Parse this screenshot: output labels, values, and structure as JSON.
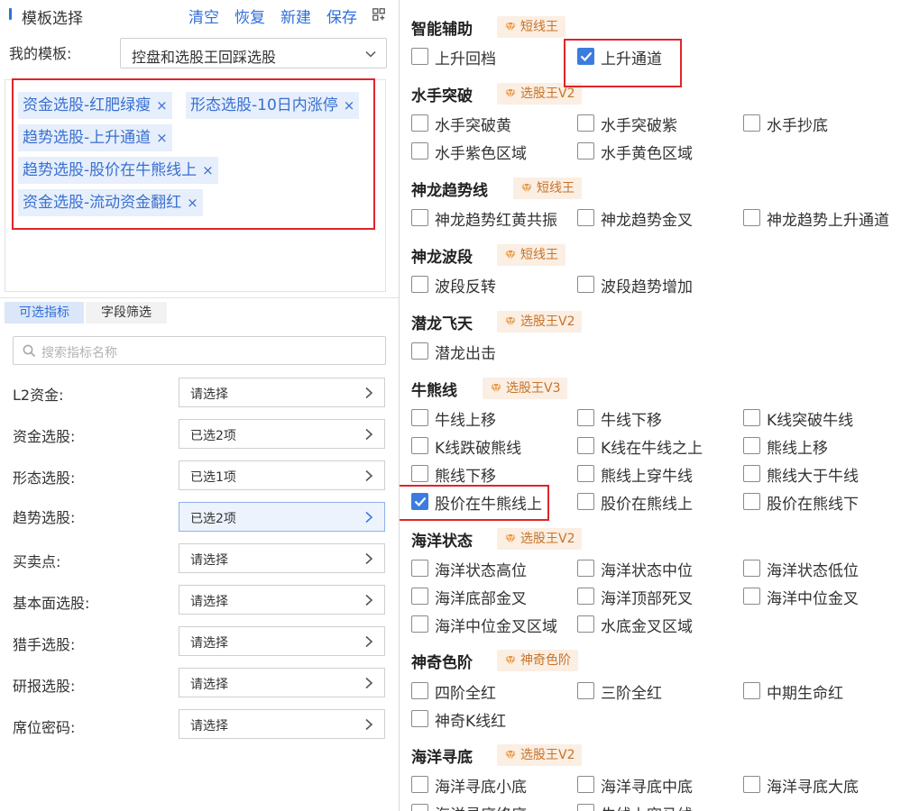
{
  "header": {
    "title": "模板选择",
    "actions": [
      "清空",
      "恢复",
      "新建",
      "保存"
    ]
  },
  "template": {
    "label": "我的模板:",
    "selected": "控盘和选股王回踩选股"
  },
  "selected_tags": [
    "资金选股-红肥绿瘦",
    "形态选股-10日内涨停",
    "趋势选股-上升通道",
    "趋势选股-股价在牛熊线上",
    "资金选股-流动资金翻红"
  ],
  "tabs": [
    "可选指标",
    "字段筛选"
  ],
  "search": {
    "placeholder": "搜索指标名称"
  },
  "filters": [
    {
      "label": "L2资金:",
      "value": "请选择"
    },
    {
      "label": "资金选股:",
      "value": "已选2项"
    },
    {
      "label": "形态选股:",
      "value": "已选1项"
    },
    {
      "label": "趋势选股:",
      "value": "已选2项"
    },
    {
      "label": "买卖点:",
      "value": "请选择"
    },
    {
      "label": "基本面选股:",
      "value": "请选择"
    },
    {
      "label": "猎手选股:",
      "value": "请选择"
    },
    {
      "label": "研报选股:",
      "value": "请选择"
    },
    {
      "label": "席位密码:",
      "value": "请选择"
    }
  ],
  "sections": [
    {
      "title": "智能辅助",
      "badge": "短线王",
      "items": [
        {
          "label": "上升回档",
          "checked": false
        },
        {
          "label": "上升通道",
          "checked": true
        }
      ]
    },
    {
      "title": "水手突破",
      "badge": "选股王V2",
      "items": [
        {
          "label": "水手突破黄",
          "checked": false
        },
        {
          "label": "水手突破紫",
          "checked": false
        },
        {
          "label": "水手抄底",
          "checked": false
        },
        {
          "label": "水手紫色区域",
          "checked": false
        },
        {
          "label": "水手黄色区域",
          "checked": false
        }
      ]
    },
    {
      "title": "神龙趋势线",
      "badge": "短线王",
      "items": [
        {
          "label": "神龙趋势红黄共振",
          "checked": false
        },
        {
          "label": "神龙趋势金叉",
          "checked": false
        },
        {
          "label": "神龙趋势上升通道",
          "checked": false
        }
      ]
    },
    {
      "title": "神龙波段",
      "badge": "短线王",
      "items": [
        {
          "label": "波段反转",
          "checked": false
        },
        {
          "label": "波段趋势增加",
          "checked": false
        }
      ]
    },
    {
      "title": "潜龙飞天",
      "badge": "选股王V2",
      "items": [
        {
          "label": "潜龙出击",
          "checked": false
        }
      ]
    },
    {
      "title": "牛熊线",
      "badge": "选股王V3",
      "items": [
        {
          "label": "牛线上移",
          "checked": false
        },
        {
          "label": "牛线下移",
          "checked": false
        },
        {
          "label": "K线突破牛线",
          "checked": false
        },
        {
          "label": "K线跌破熊线",
          "checked": false
        },
        {
          "label": "K线在牛线之上",
          "checked": false
        },
        {
          "label": "熊线上移",
          "checked": false
        },
        {
          "label": "熊线下移",
          "checked": false
        },
        {
          "label": "熊线上穿牛线",
          "checked": false
        },
        {
          "label": "熊线大于牛线",
          "checked": false
        },
        {
          "label": "股价在牛熊线上",
          "checked": true
        },
        {
          "label": "股价在熊线上",
          "checked": false
        },
        {
          "label": "股价在熊线下",
          "checked": false
        }
      ]
    },
    {
      "title": "海洋状态",
      "badge": "选股王V2",
      "items": [
        {
          "label": "海洋状态高位",
          "checked": false
        },
        {
          "label": "海洋状态中位",
          "checked": false
        },
        {
          "label": "海洋状态低位",
          "checked": false
        },
        {
          "label": "海洋底部金叉",
          "checked": false
        },
        {
          "label": "海洋顶部死叉",
          "checked": false
        },
        {
          "label": "海洋中位金叉",
          "checked": false
        },
        {
          "label": "海洋中位金叉区域",
          "checked": false
        },
        {
          "label": "水底金叉区域",
          "checked": false
        }
      ]
    },
    {
      "title": "神奇色阶",
      "badge": "神奇色阶",
      "items": [
        {
          "label": "四阶全红",
          "checked": false
        },
        {
          "label": "三阶全红",
          "checked": false
        },
        {
          "label": "中期生命红",
          "checked": false
        },
        {
          "label": "神奇K线红",
          "checked": false
        }
      ]
    },
    {
      "title": "海洋寻底",
      "badge": "选股王V2",
      "items": [
        {
          "label": "海洋寻底小底",
          "checked": false
        },
        {
          "label": "海洋寻底中底",
          "checked": false
        },
        {
          "label": "海洋寻底大底",
          "checked": false
        },
        {
          "label": "海洋寻底终底",
          "checked": false
        },
        {
          "label": "牛线上穿马线",
          "checked": false
        }
      ]
    }
  ],
  "colors": {
    "accent": "#2f6fd8",
    "highlight_border": "#e0242b",
    "badge_bg": "#fbeee3",
    "badge_text": "#c6742a",
    "checkbox_on": "#3c7ce0"
  }
}
